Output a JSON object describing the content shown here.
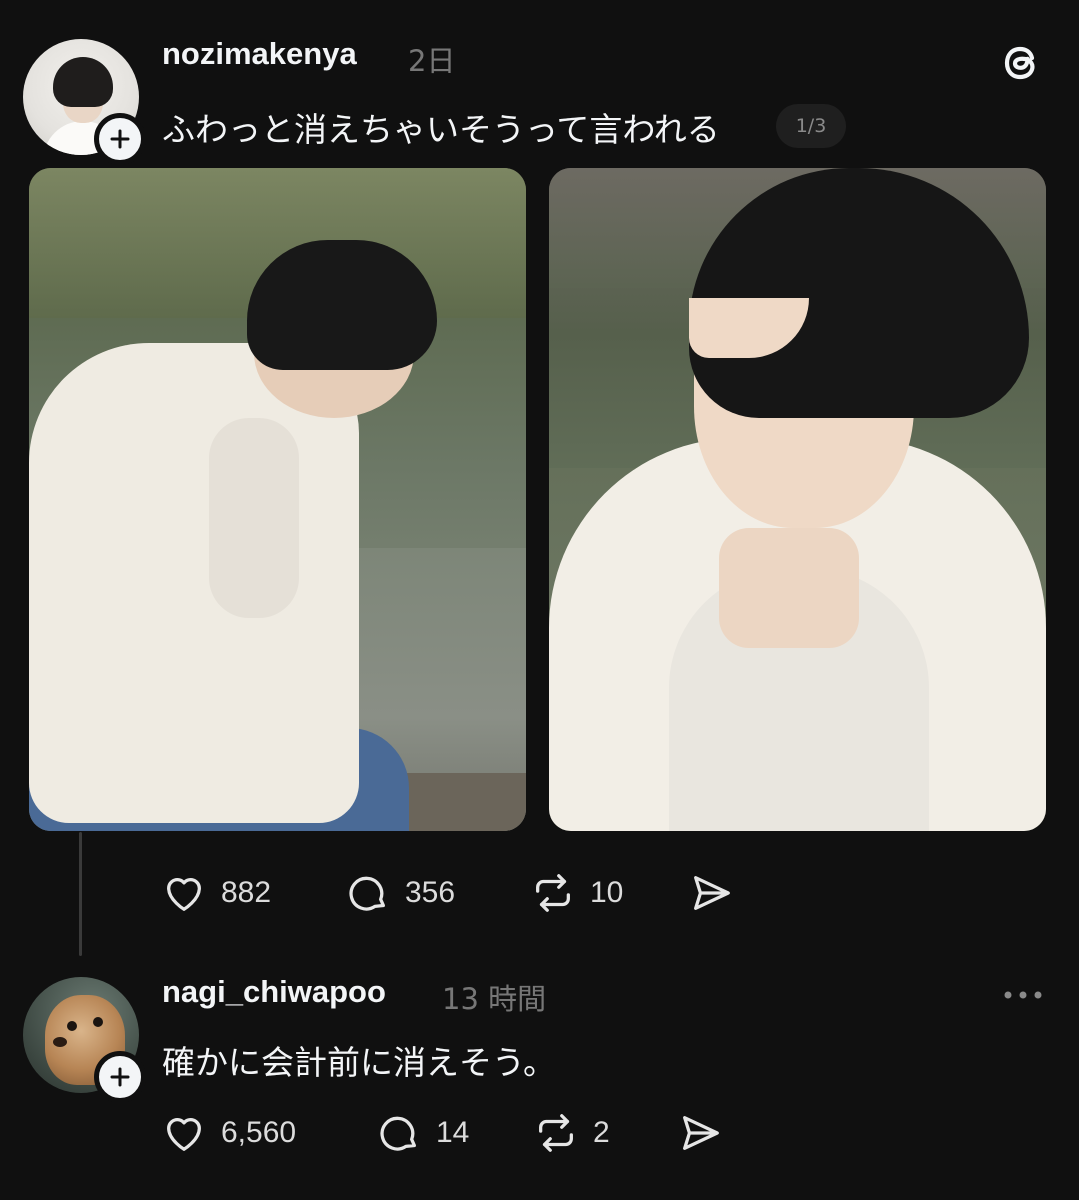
{
  "post": {
    "username": "nozimakenya",
    "timestamp": "2日",
    "text": "ふわっと消えちゃいそうって言われる",
    "page_indicator": "1/3",
    "actions": {
      "likes": "882",
      "comments": "356",
      "reposts": "10"
    }
  },
  "reply": {
    "username": "nagi_chiwapoo",
    "timestamp": "13 時間",
    "text": "確かに会計前に消えそう。",
    "actions": {
      "likes": "6,560",
      "comments": "14",
      "reposts": "2"
    }
  },
  "icons": {
    "logo": "threads-logo-icon",
    "follow": "plus-icon",
    "like": "heart-icon",
    "comment": "comment-bubble-icon",
    "repost": "repost-icon",
    "share": "send-icon",
    "more": "more-dots-icon"
  },
  "colors": {
    "background": "#101010",
    "primary_text": "#f3f5f7",
    "secondary_text": "#777777",
    "thread_line": "#3a3a3a"
  }
}
